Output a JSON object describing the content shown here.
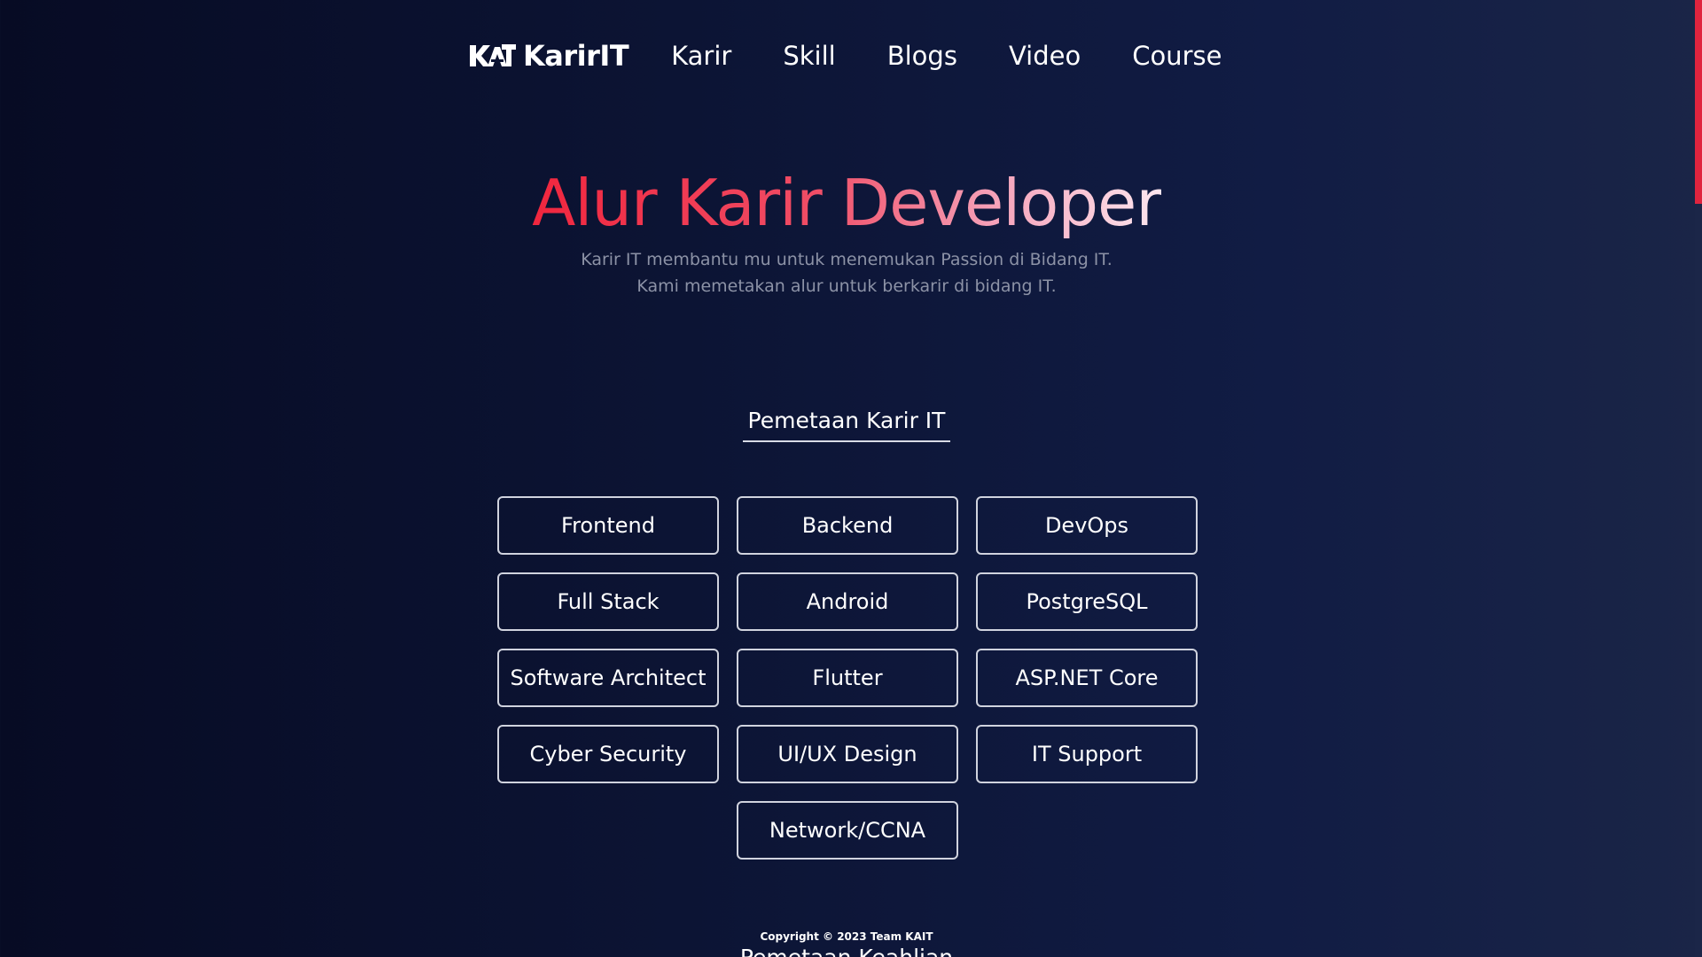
{
  "nav": {
    "brand": "KarirIT",
    "links": [
      "Karir",
      "Skill",
      "Blogs",
      "Video",
      "Course"
    ]
  },
  "hero": {
    "title": "Alur Karir Developer",
    "subtitle_line1": "Karir IT membantu mu untuk menemukan Passion di Bidang IT.",
    "subtitle_line2": "Kami memetakan alur untuk berkarir di bidang IT."
  },
  "section": {
    "heading": "Pemetaan Karir IT"
  },
  "careers": [
    "Frontend",
    "Backend",
    "DevOps",
    "Full Stack",
    "Android",
    "PostgreSQL",
    "Software Architect",
    "Flutter",
    "ASP.NET Core",
    "Cyber Security",
    "UI/UX Design",
    "IT Support",
    "Network/CCNA"
  ],
  "footer": {
    "copyright": "Copyright © 2023 Team KAIT",
    "next_heading": "Pemetaan Keahlian"
  },
  "colors": {
    "accent": "#f0263e",
    "background": "#0c1434",
    "subtitle": "#8c92a6"
  }
}
